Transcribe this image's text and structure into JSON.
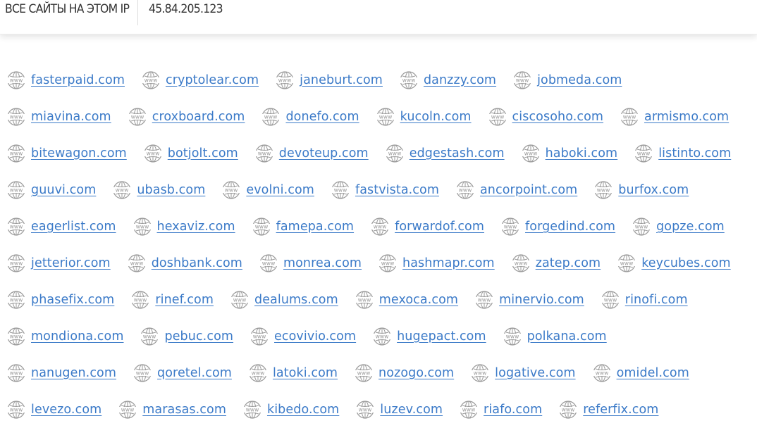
{
  "header": {
    "title": "ВСЕ САЙТЫ НА ЭТОМ IP",
    "ip": "45.84.205.123"
  },
  "icon": {
    "name": "www-globe-icon",
    "label": "www",
    "color": "#9a9a9a"
  },
  "colors": {
    "link": "#3b7ac8",
    "header_text": "#333333",
    "background": "#ffffff"
  },
  "site_rows": [
    [
      "fasterpaid.com",
      "cryptolear.com",
      "janeburt.com",
      "danzzy.com",
      "jobmeda.com"
    ],
    [
      "miavina.com",
      "croxboard.com",
      "donefo.com",
      "kucoln.com",
      "ciscosoho.com",
      "armismo.com"
    ],
    [
      "bitewagon.com",
      "botjolt.com",
      "devoteup.com",
      "edgestash.com",
      "haboki.com",
      "listinto.com"
    ],
    [
      "guuvi.com",
      "ubasb.com",
      "evolni.com",
      "fastvista.com",
      "ancorpoint.com",
      "burfox.com"
    ],
    [
      "eagerlist.com",
      "hexaviz.com",
      "famepa.com",
      "forwardof.com",
      "forgedind.com",
      "gopze.com"
    ],
    [
      "jetterior.com",
      "doshbank.com",
      "monrea.com",
      "hashmapr.com",
      "zatep.com",
      "keycubes.com"
    ],
    [
      "phasefix.com",
      "rinef.com",
      "dealums.com",
      "mexoca.com",
      "minervio.com",
      "rinofi.com"
    ],
    [
      "mondiona.com",
      "pebuc.com",
      "ecovivio.com",
      "hugepact.com",
      "polkana.com"
    ],
    [
      "nanugen.com",
      "qoretel.com",
      "latoki.com",
      "nozogo.com",
      "logative.com",
      "omidel.com"
    ],
    [
      "levezo.com",
      "marasas.com",
      "kibedo.com",
      "luzev.com",
      "riafo.com",
      "referfix.com"
    ]
  ]
}
